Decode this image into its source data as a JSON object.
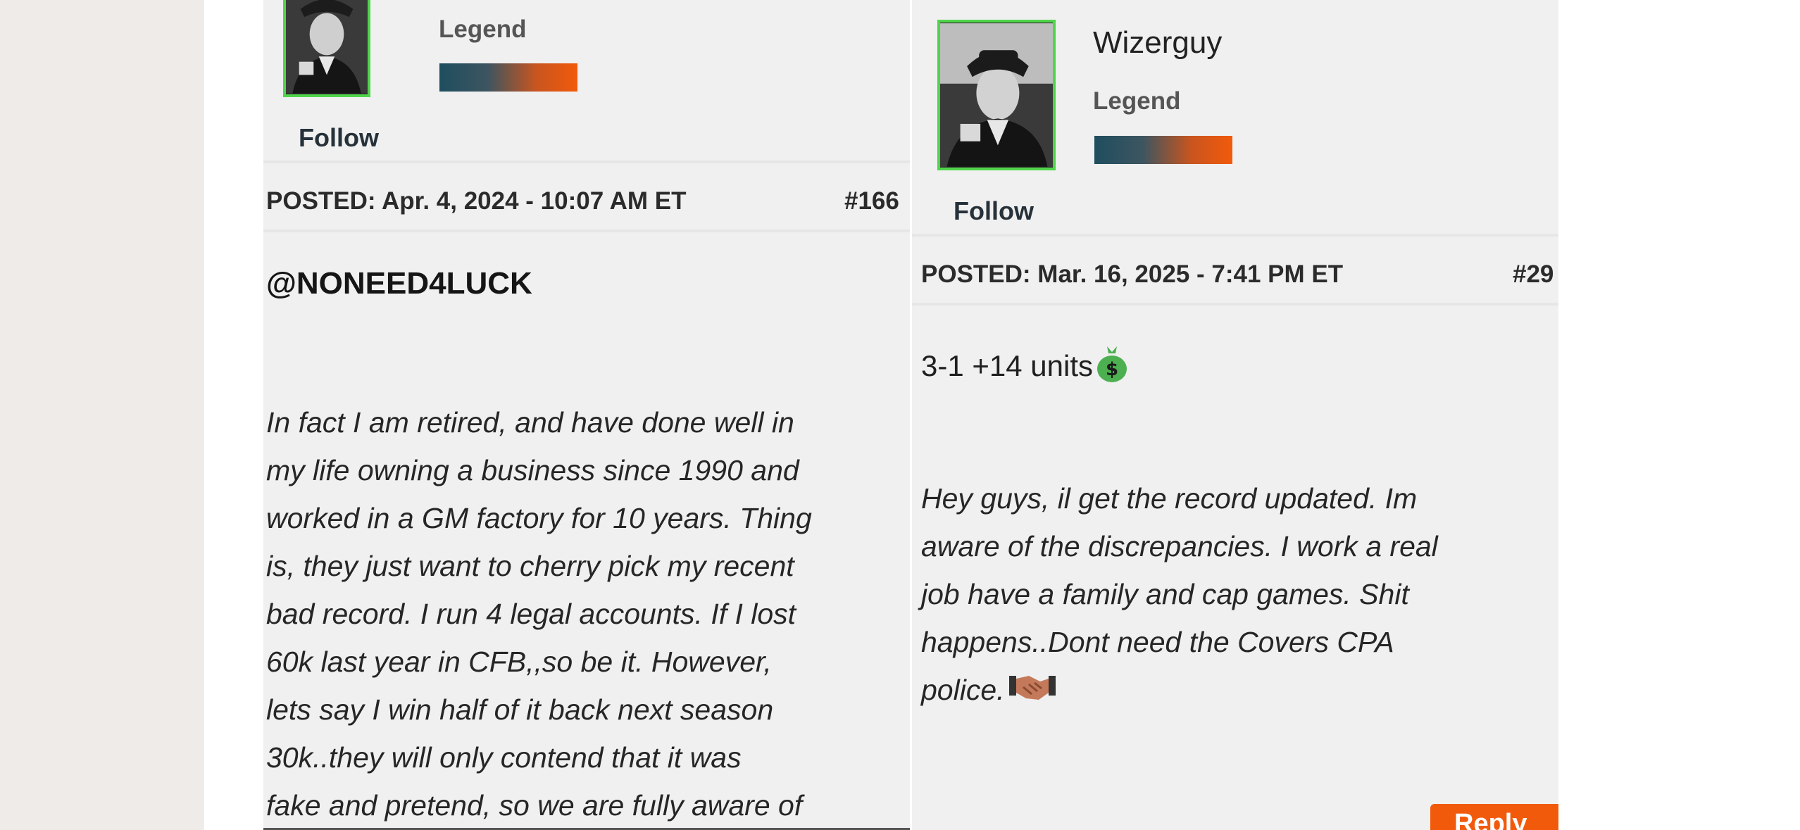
{
  "left_post": {
    "rank": "Legend",
    "follow_label": "Follow",
    "posted": "POSTED: Apr. 4, 2024 - 10:07 AM ET",
    "post_number": "#166",
    "mention": "@NONEED4LUCK",
    "body_lines": [
      "In fact I am retired, and have done well in",
      "my life owning a business since 1990 and",
      "worked in a GM factory for 10 years. Thing",
      "is, they just want to cherry pick my recent",
      "bad record. I run 4 legal accounts. If I lost",
      "60k last year in CFB,,so be it. However,",
      "lets say I win half of it back next season",
      "30k..they will only contend that it was",
      "fake and pretend, so we are fully aware of"
    ]
  },
  "right_post": {
    "username": "Wizerguy",
    "rank": "Legend",
    "follow_label": "Follow",
    "posted": "POSTED: Mar. 16, 2025 - 7:41 PM ET",
    "post_number": "#29",
    "record": "3-1 +14 units",
    "body_lines": [
      "Hey guys, il get the record updated. Im",
      "aware of the discrepancies. I work a real",
      "job have a family and cap games. Shit",
      "happens..Dont need the Covers CPA",
      "police."
    ],
    "reply_label": "Reply"
  },
  "colors": {
    "accent": "#f25a0b",
    "avatar_border": "#4fd44a",
    "rank_bar_start": "#1f4e5f",
    "background": "#f0f0f0"
  },
  "icons": [
    "money-bag-emoji",
    "handshake-emoji"
  ]
}
